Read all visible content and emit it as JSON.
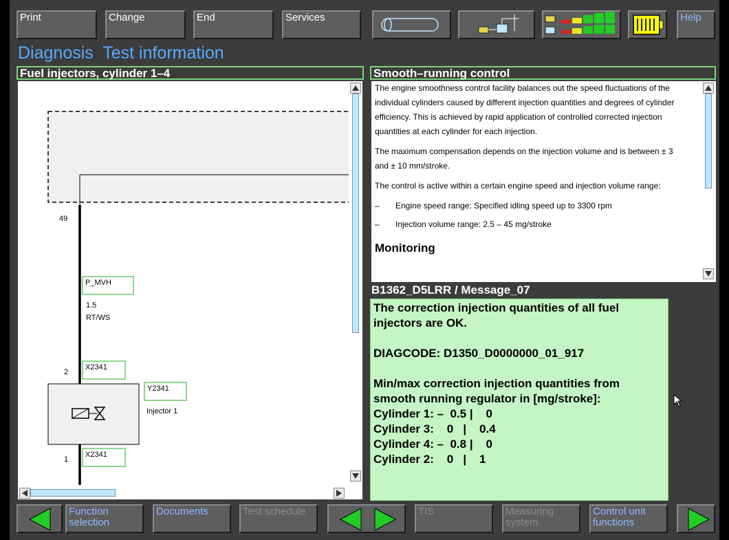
{
  "toolbar": {
    "print": "Print",
    "change": "Change",
    "end": "End",
    "services": "Services",
    "help": "Help"
  },
  "title": {
    "diagnosis": "Diagnosis",
    "test_information": "Test information"
  },
  "left_panel": {
    "header": "Fuel injectors, cylinder 1–4",
    "diagram": {
      "pin_49": "49",
      "wire_label": "P_MVH",
      "wire_size": "1.5",
      "wire_color": "RT/WS",
      "pin_2": "2",
      "connector_top": "X2341",
      "component_id": "Y2341",
      "component_name": "Injector 1",
      "pin_1": "1",
      "connector_bottom": "X2341"
    }
  },
  "right_panel": {
    "header": "Smooth–running control",
    "paragraphs": [
      "The engine smoothness control facility balances out the speed fluctuations of the individual cylinders caused by different injection quantities and degrees of cylinder efficiency. This is achieved by rapid application of controlled corrected injection quantities at each cylinder for each injection.",
      "The maximum compensation depends on the injection volume and is between ± 3 and  ± 10 mm/stroke.",
      "The control is active within a certain engine speed and injection volume range:"
    ],
    "bullets": [
      {
        "dash": "–",
        "text": "Engine speed range: Specified idling speed up to 3300 rpm"
      },
      {
        "dash": "–",
        "text": "Injection volume range: 2.5 – 45 mg/stroke"
      }
    ],
    "monitoring": "Monitoring"
  },
  "message": {
    "header": "B1362_D5LRR / Message_07",
    "lines": [
      "The correction injection quantities of all fuel",
      "injectors are OK.",
      "",
      "DIAGCODE: D1350_D0000000_01_917",
      "",
      "Min/max correction injection quantities from",
      "smooth running regulator in [mg/stroke]:",
      "Cylinder 1: –  0.5 |    0",
      "Cylinder 3:    0   |    0.4",
      "Cylinder 4: –  0.8 |    0",
      "Cylinder 2:    0   |    1"
    ]
  },
  "bottom": {
    "function_selection": "Function selection",
    "documents": "Documents",
    "test_schedule": "Test schedule",
    "tis": "TIS",
    "measuring_system": "Measuring system",
    "control_unit_functions": "Control unit functions"
  },
  "colors": {
    "accent_blue": "#5aa8ff",
    "panel_green_border": "#7fd17f",
    "result_background": "#c5f5c5",
    "arrow_green": "#22cc22"
  }
}
